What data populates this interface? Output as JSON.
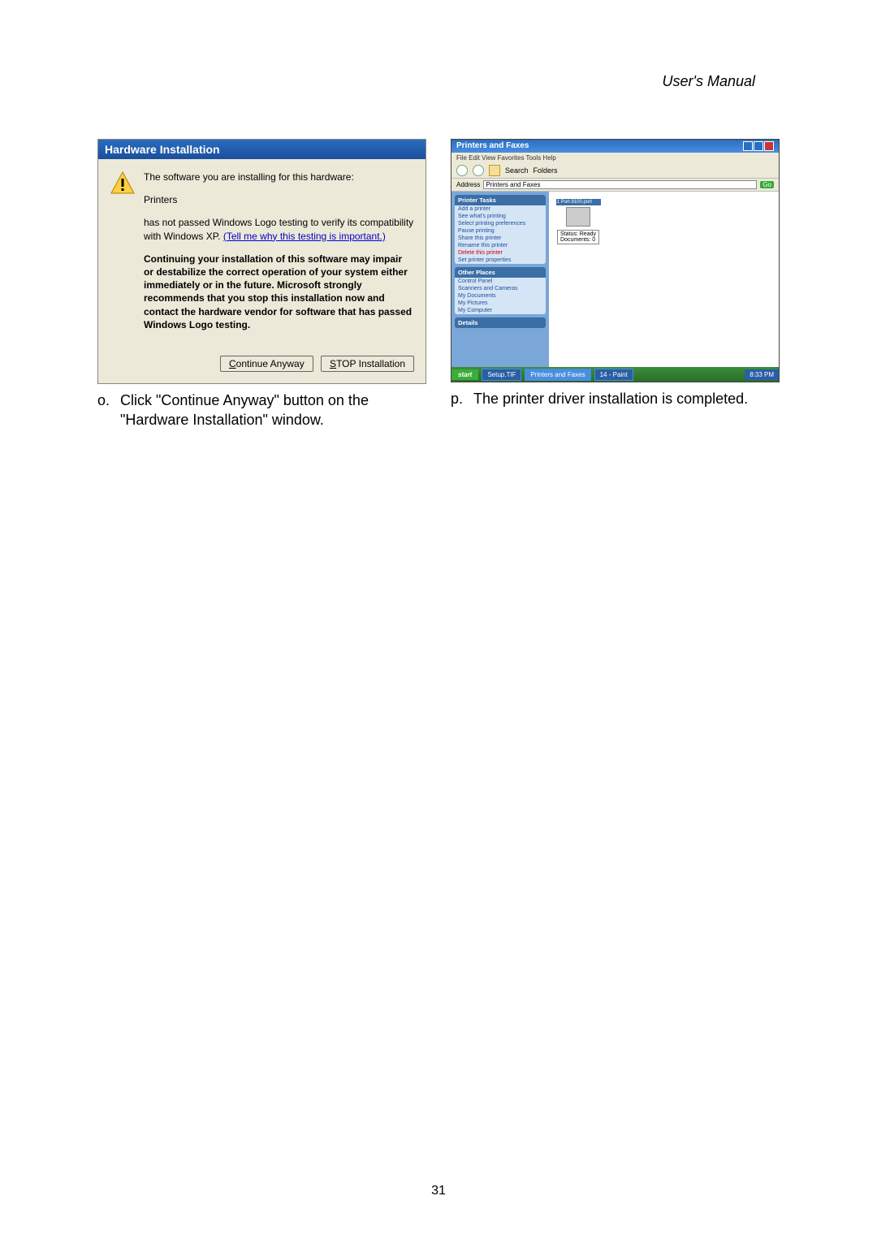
{
  "header": "User's  Manual",
  "page_number": "31",
  "left": {
    "dialog_title": "Hardware Installation",
    "line1": "The software you are installing for this hardware:",
    "line2": "Printers",
    "line3a": "has not passed Windows Logo testing to verify its compatibility with Windows XP. ",
    "line3_link": "(Tell me why this testing is important.)",
    "bold": "Continuing your installation of this software may impair or destabilize the correct operation of your system either immediately or in the future. Microsoft strongly recommends that you stop this installation now and contact the hardware vendor for software that has passed Windows Logo testing.",
    "btn_continue_pre": "C",
    "btn_continue_rest": "ontinue Anyway",
    "btn_stop_pre": "S",
    "btn_stop_rest": "TOP Installation",
    "caption_letter": "o.",
    "caption_text": "Click \"Continue Anyway\" button on the \"Hardware Installation\" window."
  },
  "right": {
    "win_title": "Printers and Faxes",
    "menu": "File   Edit   View   Favorites   Tools   Help",
    "tool_search": "Search",
    "tool_folders": "Folders",
    "addr_label": "Address",
    "addr_value": "Printers and Faxes",
    "go": "Go",
    "panel1_head": "Printer Tasks",
    "panel1_items": [
      "Add a printer",
      "See what's printing",
      "Select printing preferences",
      "Pause printing",
      "Share this printer",
      "Rename this printer",
      "Delete this printer",
      "Set printer properties"
    ],
    "panel2_head": "Other Places",
    "panel2_items": [
      "Control Panel",
      "Scanners and Cameras",
      "My Documents",
      "My Pictures",
      "My Computer"
    ],
    "panel3_head": "Details",
    "printer_top": "1 Port-9100.port",
    "printer_status": "Status: Ready",
    "printer_docs": "Documents: 0",
    "start": "start",
    "task1": "Setup.TIF",
    "task2": "Printers and Faxes",
    "task3": "14 - Paint",
    "tray": "8:33 PM",
    "caption_letter": "p.",
    "caption_text": "The printer driver installation is completed."
  }
}
